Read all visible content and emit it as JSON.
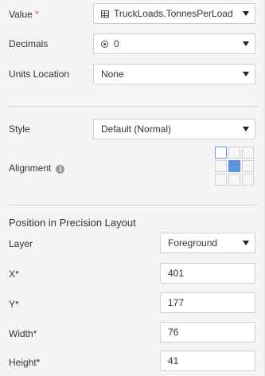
{
  "value": {
    "label": "Value",
    "required_mark": "*",
    "selected": "TruckLoads.TonnesPerLoad",
    "icon": "table-icon"
  },
  "decimals": {
    "label": "Decimals",
    "selected": "0",
    "icon": "radio-target-icon"
  },
  "units_location": {
    "label": "Units Location",
    "selected": "None"
  },
  "style": {
    "label": "Style",
    "selected": "Default (Normal)"
  },
  "alignment": {
    "label": "Alignment",
    "info_icon": "info-icon",
    "grid": [
      "top-left",
      "top-center",
      "top-right",
      "middle-left",
      "middle-center",
      "middle-right",
      "bottom-left",
      "bottom-center",
      "bottom-right"
    ],
    "selected": "middle-center",
    "hovered": "top-left",
    "accent_color": "#5e93dc"
  },
  "precision_layout": {
    "title": "Position in Precision Layout",
    "layer": {
      "label": "Layer",
      "selected": "Foreground"
    },
    "x": {
      "label": "X*",
      "value": "401"
    },
    "y": {
      "label": "Y*",
      "value": "177"
    },
    "width": {
      "label": "Width*",
      "value": "76"
    },
    "height": {
      "label": "Height*",
      "value": "41"
    }
  }
}
